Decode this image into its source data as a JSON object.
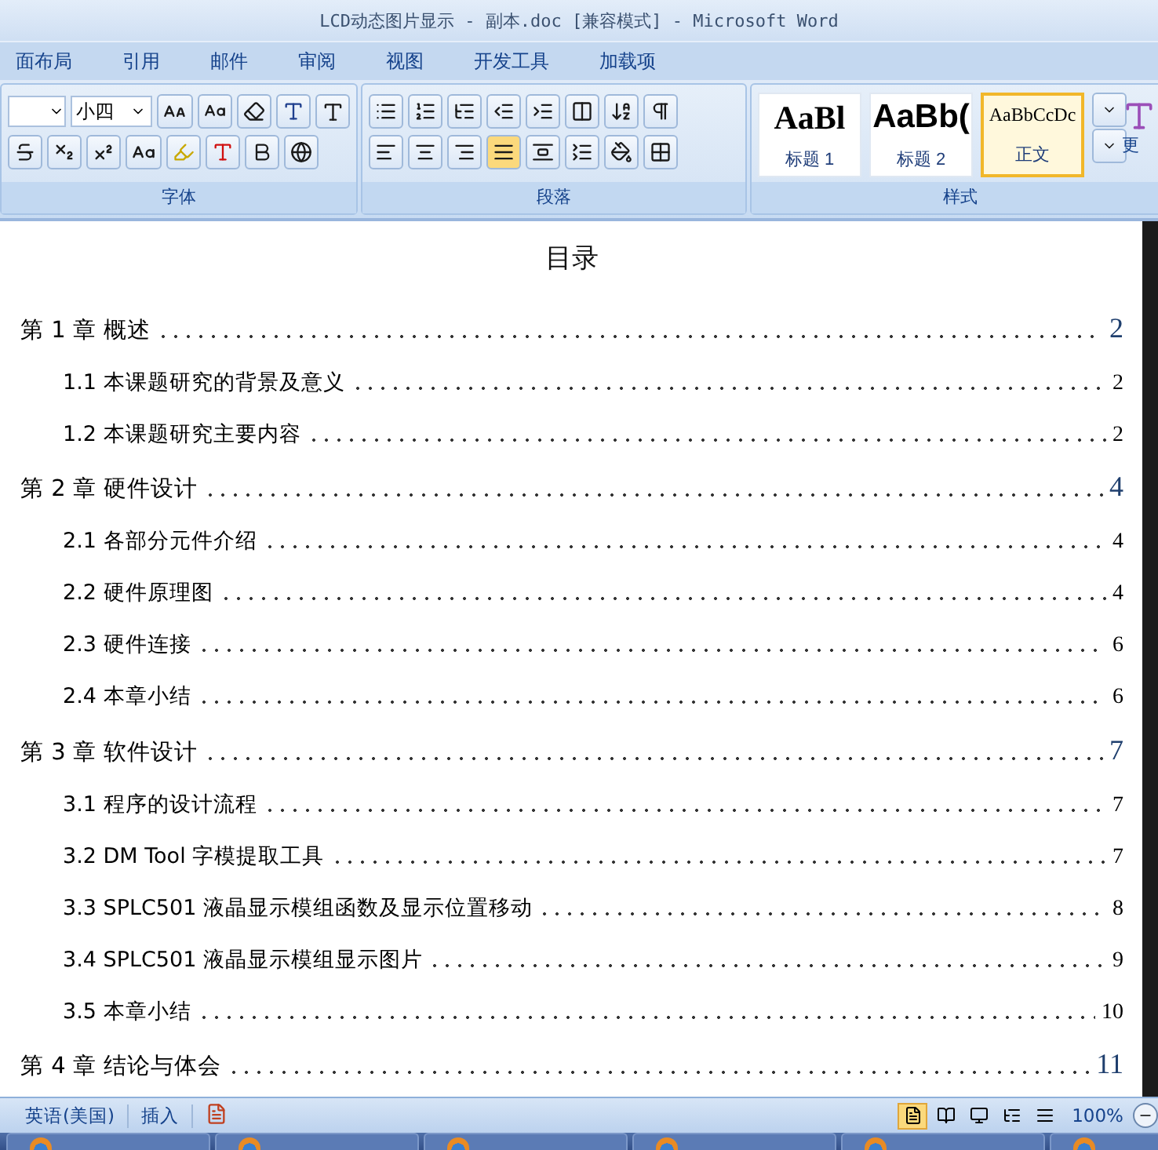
{
  "window": {
    "title": "LCD动态图片显示 - 副本.doc [兼容模式] - Microsoft Word"
  },
  "tabs": [
    {
      "label": "面布局",
      "selected": false
    },
    {
      "label": "引用",
      "selected": false
    },
    {
      "label": "邮件",
      "selected": false
    },
    {
      "label": "审阅",
      "selected": false
    },
    {
      "label": "视图",
      "selected": false
    },
    {
      "label": "开发工具",
      "selected": false
    },
    {
      "label": "加载项",
      "selected": false
    }
  ],
  "ribbon": {
    "font_size": "小四",
    "groups": [
      "字体",
      "段落",
      "样式"
    ],
    "styles": [
      {
        "preview": "AaBl",
        "name": "标题 1",
        "selected": false
      },
      {
        "preview": "AaBb(",
        "name": "标题 2",
        "selected": false
      },
      {
        "preview": "AaBbCcDc",
        "name": "正文",
        "selected": true
      }
    ],
    "change_styles": "更"
  },
  "document": {
    "heading": "目录",
    "toc": [
      {
        "title": "第 1 章  概述",
        "page": "2",
        "children": [
          {
            "title": "1.1 本课题研究的背景及意义",
            "page": "2"
          },
          {
            "title": "1.2 本课题研究主要内容",
            "page": "2"
          }
        ]
      },
      {
        "title": "第 2 章  硬件设计",
        "page": "4",
        "children": [
          {
            "title": "2.1  各部分元件介绍",
            "page": "4"
          },
          {
            "title": "2.2  硬件原理图",
            "page": "4"
          },
          {
            "title": "2.3  硬件连接",
            "page": "6"
          },
          {
            "title": "2.4  本章小结",
            "page": "6"
          }
        ]
      },
      {
        "title": "第 3 章  软件设计",
        "page": "7",
        "children": [
          {
            "title": "3.1 程序的设计流程",
            "page": "7"
          },
          {
            "title": "3.2 DM Tool 字模提取工具",
            "page": "7"
          },
          {
            "title": "3.3  SPLC501 液晶显示模组函数及显示位置移动",
            "page": "8"
          },
          {
            "title": "3.4  SPLC501 液晶显示模组显示图片",
            "page": "9"
          },
          {
            "title": "3.5  本章小结",
            "page": "10"
          }
        ]
      },
      {
        "title": "第 4 章  结论与体会",
        "page": "11"
      }
    ]
  },
  "status_bar": {
    "language": "英语(美国)",
    "mode": "插入",
    "zoom": "100%"
  }
}
